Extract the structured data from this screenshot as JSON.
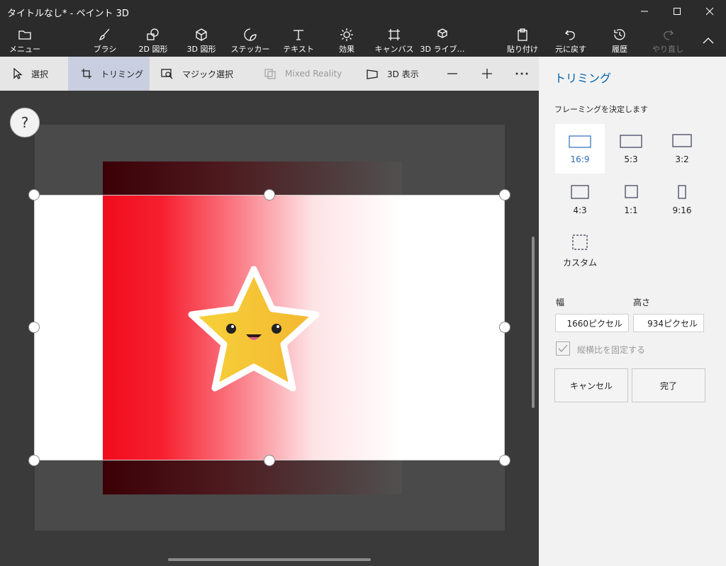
{
  "window": {
    "title": "タイトルなし* - ペイント 3D"
  },
  "ribbon": {
    "menu": "メニュー",
    "tools": [
      "ブラシ",
      "2D 図形",
      "3D 図形",
      "ステッカー",
      "テキスト",
      "効果",
      "キャンバス",
      "3D ライブ…"
    ],
    "actions": [
      "貼り付け",
      "元に戻す",
      "履歴",
      "やり直し"
    ]
  },
  "subtoolbar": {
    "select": "選択",
    "crop": "トリミング",
    "magic_select": "マジック選択",
    "mixed_reality": "Mixed Reality",
    "view_3d": "3D 表示"
  },
  "canvas": {
    "help": "?"
  },
  "panel": {
    "title": "トリミング",
    "subtitle": "フレーミングを決定します",
    "ratios": [
      "16:9",
      "5:3",
      "3:2",
      "4:3",
      "1:1",
      "9:16",
      "カスタム"
    ],
    "selected_ratio": "16:9",
    "width_label": "幅",
    "height_label": "高さ",
    "width_value": "1660ピクセル",
    "height_value": "934ピクセル",
    "lock_aspect": "縦横比を固定する",
    "cancel": "キャンセル",
    "done": "完了"
  }
}
